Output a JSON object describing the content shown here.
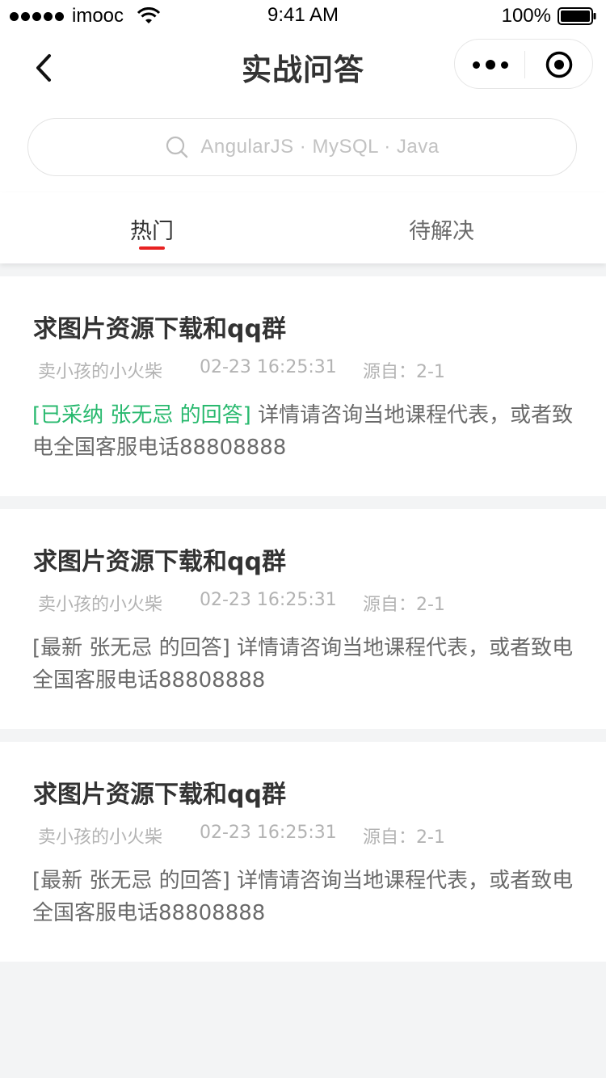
{
  "status_bar": {
    "carrier": "imooc",
    "time": "9:41 AM",
    "battery": "100%"
  },
  "nav": {
    "title": "实战问答",
    "icons": [
      "back-icon",
      "more-icon",
      "close-target-icon"
    ]
  },
  "search": {
    "placeholder": "AngularJS · MySQL · Java"
  },
  "tabs": [
    {
      "label": "热门",
      "active": true
    },
    {
      "label": "待解决",
      "active": false
    }
  ],
  "colors": {
    "accent": "#e82222",
    "accepted": "#28b96e",
    "background": "#f3f4f5"
  },
  "questions": [
    {
      "title": "求图片资源下载和qq群",
      "author": "卖小孩的小火柴",
      "time": "02-23 16:25:31",
      "source": "源自：2-1",
      "tag": "[已采纳 张无忌 的回答]",
      "tag_type": "accepted",
      "answer": " 详情请咨询当地课程代表，或者致电全国客服电话88808888"
    },
    {
      "title": "求图片资源下载和qq群",
      "author": "卖小孩的小火柴",
      "time": "02-23 16:25:31",
      "source": "源自：2-1",
      "tag": "[最新 张无忌 的回答]",
      "tag_type": "latest",
      "answer": " 详情请咨询当地课程代表，或者致电全国客服电话88808888"
    },
    {
      "title": "求图片资源下载和qq群",
      "author": "卖小孩的小火柴",
      "time": "02-23 16:25:31",
      "source": "源自：2-1",
      "tag": "[最新 张无忌 的回答]",
      "tag_type": "latest",
      "answer": " 详情请咨询当地课程代表，或者致电全国客服电话88808888"
    }
  ]
}
